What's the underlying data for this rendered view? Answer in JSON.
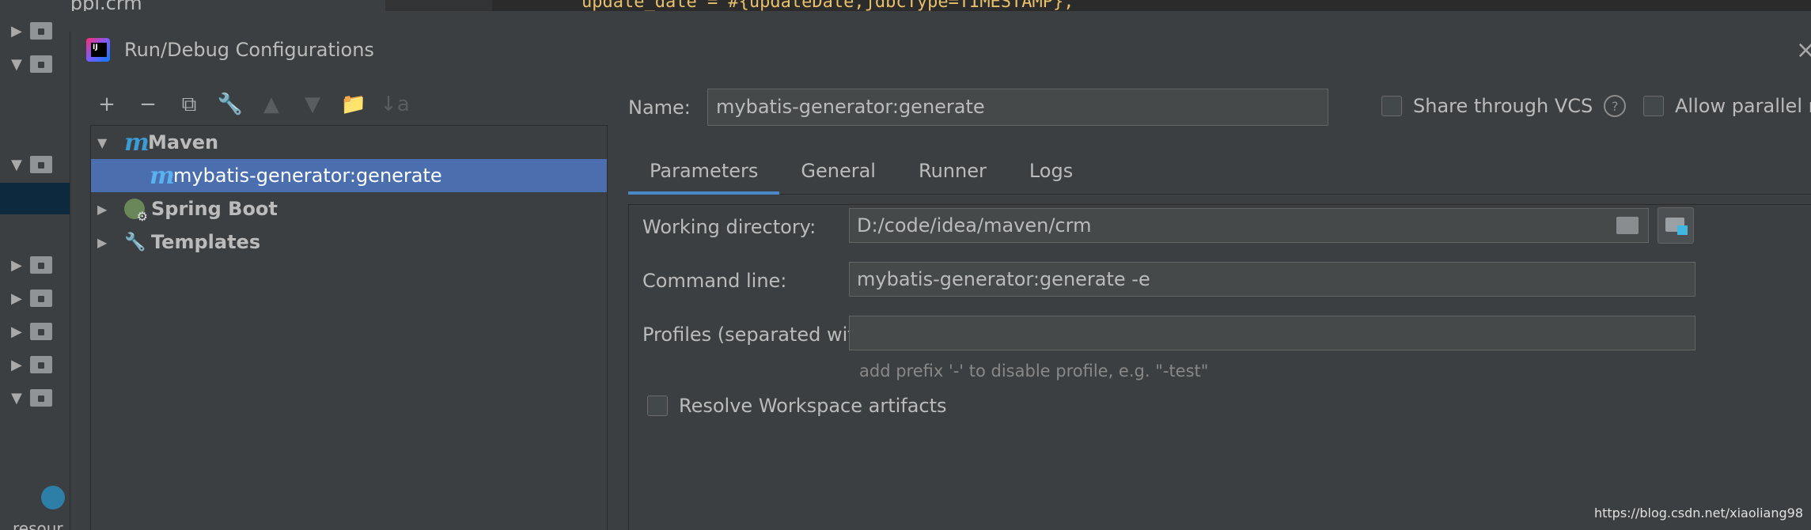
{
  "background": {
    "package_text": "com.ppl.crm",
    "code_text": "update_date = #{updateDate,jdbcType=TIMESTAMP},",
    "bottom_text": "resour"
  },
  "dialog": {
    "title": "Run/Debug Configurations",
    "close_label": "×"
  },
  "toolbar": {
    "add": "+",
    "remove": "−",
    "copy": "⧉",
    "edit_defaults": "🔧",
    "move_up": "▲",
    "move_down": "▼",
    "new_folder": "📁",
    "sort": "↓a"
  },
  "tree": {
    "maven": "Maven",
    "maven_child": "mybatis-generator:generate",
    "spring_boot": "Spring Boot",
    "templates": "Templates"
  },
  "name": {
    "label": "Name:",
    "value": "mybatis-generator:generate"
  },
  "options": {
    "share_vcs": "Share through VCS",
    "allow_parallel": "Allow parallel ru",
    "help": "?"
  },
  "tabs": [
    "Parameters",
    "General",
    "Runner",
    "Logs"
  ],
  "parameters": {
    "working_dir_label": "Working directory:",
    "working_dir_value": "D:/code/idea/maven/crm",
    "command_line_label": "Command line:",
    "command_line_value": "mybatis-generator:generate -e",
    "profiles_label": "Profiles (separated with space):",
    "profiles_value": "",
    "profiles_hint": "add prefix '-' to disable profile, e.g. \"-test\"",
    "resolve_workspace": "Resolve Workspace artifacts"
  },
  "watermark": "https://blog.csdn.net/xiaoliang98",
  "colors": {
    "background": "#3c3f41",
    "selection": "#4b6eaf",
    "tab_underline": "#4a88c7",
    "maven_icon": "#3a9bd5"
  }
}
